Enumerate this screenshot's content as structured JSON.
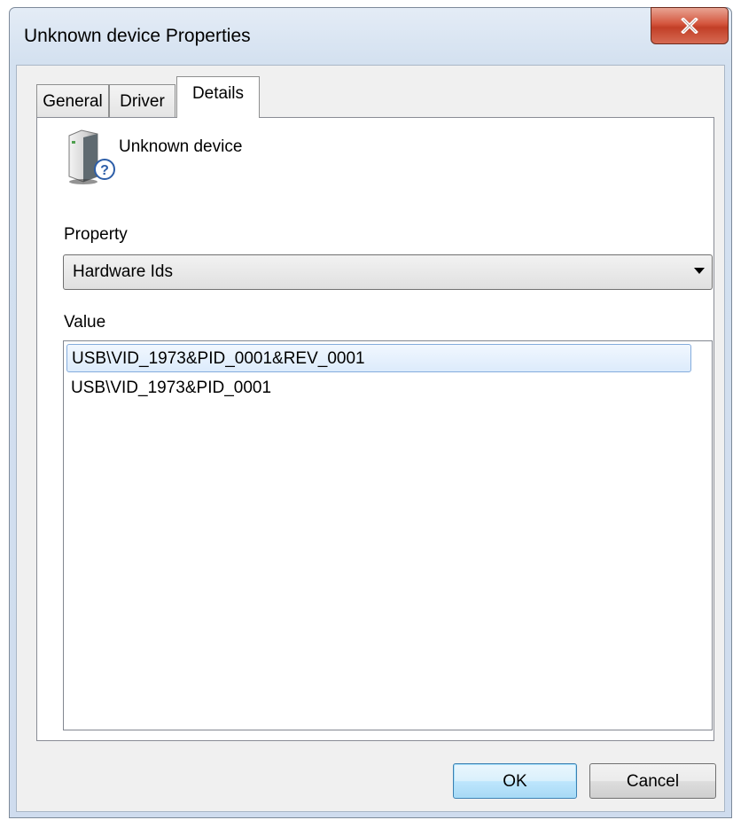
{
  "window": {
    "title": "Unknown device Properties",
    "close_label": "x"
  },
  "tabs": [
    {
      "label": "General",
      "active": false
    },
    {
      "label": "Driver",
      "active": false
    },
    {
      "label": "Details",
      "active": true
    }
  ],
  "details": {
    "device_name": "Unknown device",
    "device_icon": "unknown-device-icon",
    "property_label": "Property",
    "property_selected": "Hardware Ids",
    "value_label": "Value",
    "values": [
      "USB\\VID_1973&PID_0001&REV_0001",
      "USB\\VID_1973&PID_0001"
    ],
    "selected_index": 0
  },
  "buttons": {
    "ok": "OK",
    "cancel": "Cancel"
  },
  "colors": {
    "close_button": "#c94a31",
    "selection_border": "#84acdd",
    "default_button_border": "#3c7fb1"
  }
}
